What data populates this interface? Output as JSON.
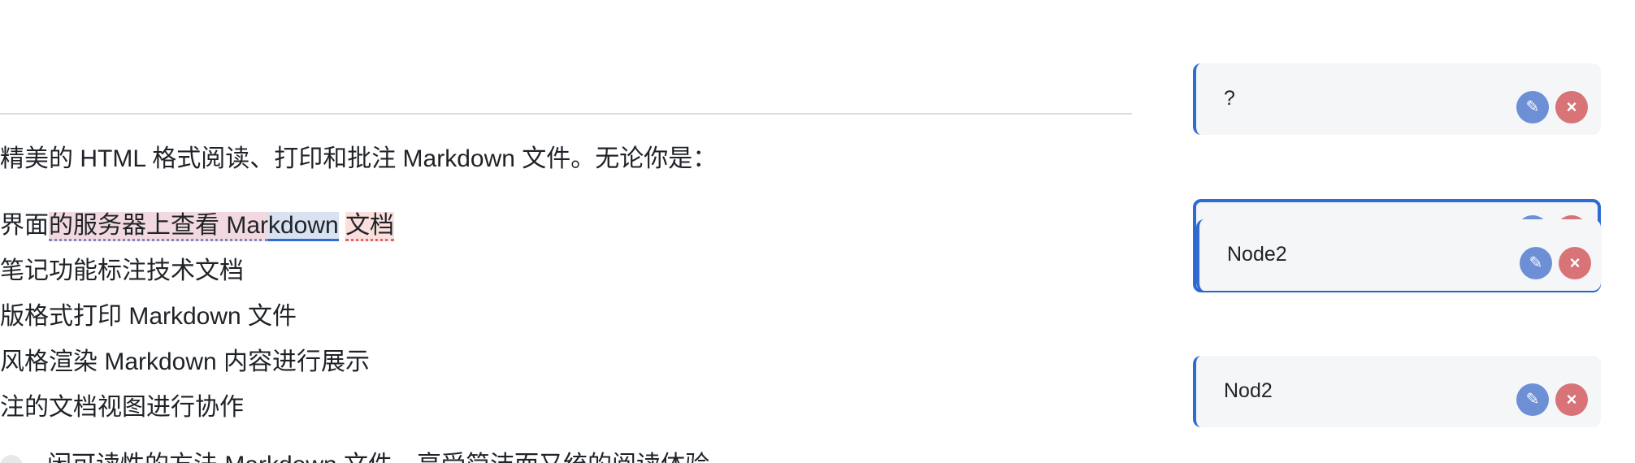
{
  "document": {
    "paragraph": "精美的 HTML 格式阅读、打印和批注 Markdown 文件。无论你是：",
    "list": [
      {
        "prefix": "界面",
        "hl_pink": "的服务器上查看 Mar",
        "hl_blue": "kdown",
        "middle": " ",
        "hl_red": "文档"
      },
      {
        "text": "笔记功能标注技术文档"
      },
      {
        "text": "版格式打印 Markdown 文件"
      },
      {
        "text": "风格渲染 Markdown 内容进行展示"
      },
      {
        "text": "注的文档视图进行协作"
      }
    ],
    "cutoff_line": "闲可读性的方法 Markdown 文件，享受简洁而又统的阅读体验"
  },
  "annotations": {
    "edit_icon": "pencil-icon",
    "delete_icon": "close-icon",
    "edit_glyph": "✎",
    "delete_glyph": "×",
    "items": [
      {
        "text": "?"
      },
      {
        "text": "Node2"
      },
      {
        "text": "Nod2"
      }
    ]
  },
  "colors": {
    "accent": "#2f6bd3",
    "edit_button": "#6c8fd6",
    "delete_button": "#d87477",
    "card_bg": "#f4f6f8"
  }
}
